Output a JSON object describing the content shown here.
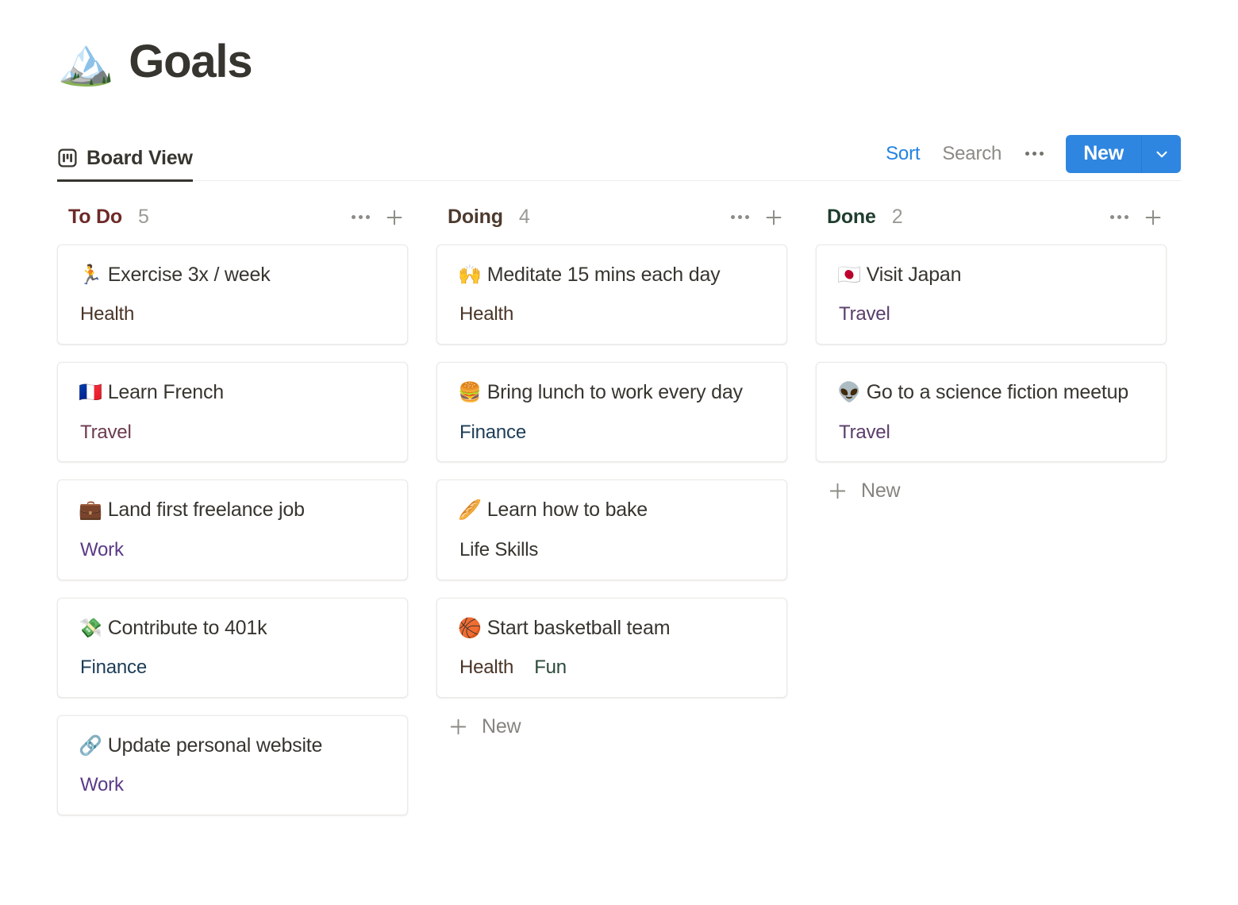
{
  "page": {
    "emoji": "🏔️",
    "title": "Goals"
  },
  "toolbar": {
    "view_tab": {
      "label": "Board View",
      "icon": "board-view-icon"
    },
    "sort_label": "Sort",
    "search_label": "Search",
    "more_label": "•••",
    "new_label": "New",
    "accent_color": "#2f86e0",
    "sort_color": "#2383e2",
    "search_color": "#8c8a85"
  },
  "board": {
    "new_row_label": "New",
    "columns": [
      {
        "name": "To Do",
        "count": "5",
        "name_color": "#6d2a28",
        "show_new": false,
        "cards": [
          {
            "emoji": "🏃",
            "title": "Exercise 3x / week",
            "tags": [
              {
                "label": "Health",
                "color": "#4a3527"
              }
            ]
          },
          {
            "emoji": "🇫🇷",
            "title": "Learn French",
            "tags": [
              {
                "label": "Travel",
                "color": "#6b3a4d"
              }
            ]
          },
          {
            "emoji": "💼",
            "title": "Land first freelance job",
            "tags": [
              {
                "label": "Work",
                "color": "#5b3a87"
              }
            ]
          },
          {
            "emoji": "💸",
            "title": "Contribute to 401k",
            "tags": [
              {
                "label": "Finance",
                "color": "#1c3d57"
              }
            ]
          },
          {
            "emoji": "🔗",
            "title": "Update personal website",
            "tags": [
              {
                "label": "Work",
                "color": "#5b3a87"
              }
            ]
          }
        ]
      },
      {
        "name": "Doing",
        "count": "4",
        "name_color": "#4d3b2f",
        "show_new": true,
        "cards": [
          {
            "emoji": "🙌",
            "title": "Meditate 15 mins each day",
            "tags": [
              {
                "label": "Health",
                "color": "#4a3527"
              }
            ]
          },
          {
            "emoji": "🍔",
            "title": "Bring lunch to work every day",
            "tags": [
              {
                "label": "Finance",
                "color": "#1c3d57"
              }
            ]
          },
          {
            "emoji": "🥖",
            "title": "Learn how to bake",
            "tags": [
              {
                "label": "Life Skills",
                "color": "#37352f"
              }
            ]
          },
          {
            "emoji": "🏀",
            "title": "Start basketball team",
            "tags": [
              {
                "label": "Health",
                "color": "#4a3527"
              },
              {
                "label": "Fun",
                "color": "#2b4a3a"
              }
            ]
          }
        ]
      },
      {
        "name": "Done",
        "count": "2",
        "name_color": "#1f3d2e",
        "show_new": true,
        "cards": [
          {
            "emoji": "🇯🇵",
            "title": "Visit Japan",
            "tags": [
              {
                "label": "Travel",
                "color": "#5a3d6b"
              }
            ]
          },
          {
            "emoji": "👽",
            "title": "Go to a science fiction meetup",
            "tags": [
              {
                "label": "Travel",
                "color": "#5a3d6b"
              }
            ]
          }
        ]
      }
    ]
  }
}
